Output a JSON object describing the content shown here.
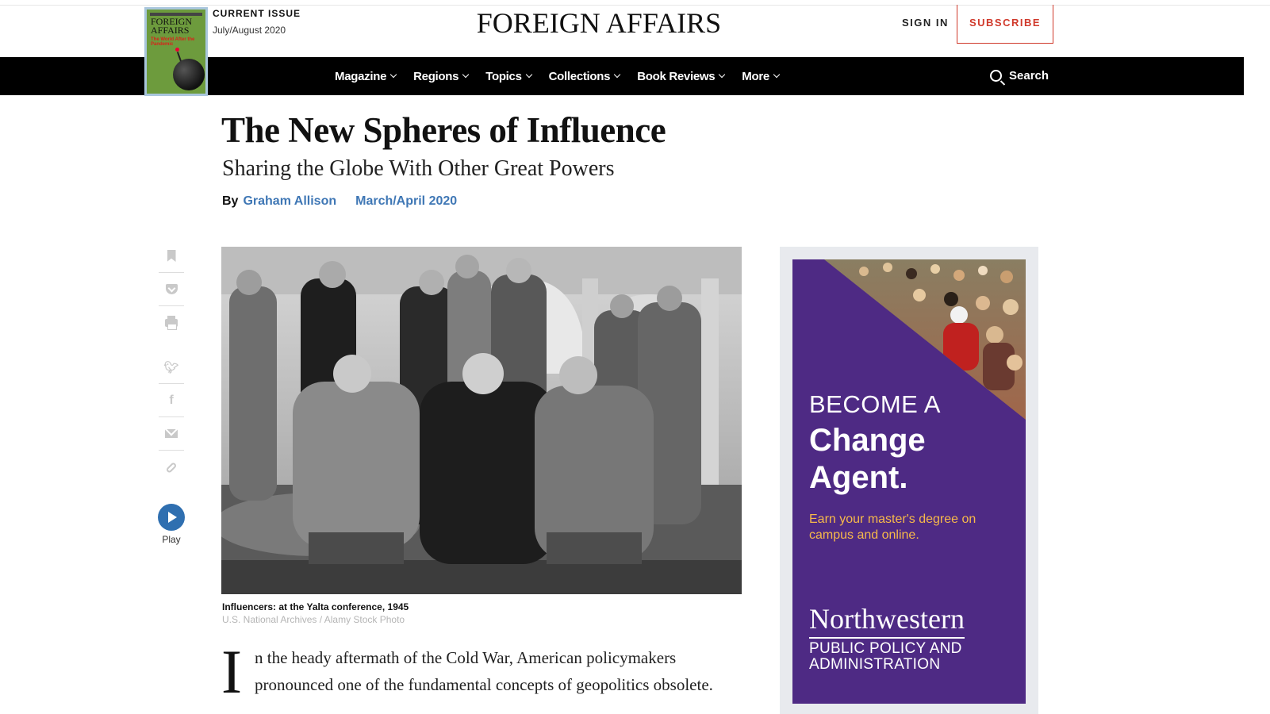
{
  "header": {
    "current_issue_label": "CURRENT ISSUE",
    "current_issue_date": "July/August 2020",
    "cover": {
      "logo": "FOREIGN AFFAIRS",
      "cover_line": "The World After the Pandemic"
    },
    "logo": "FOREIGN AFFAIRS",
    "sign_in": "SIGN IN",
    "subscribe": "SUBSCRIBE"
  },
  "nav": {
    "items": [
      {
        "label": "Magazine"
      },
      {
        "label": "Regions"
      },
      {
        "label": "Topics"
      },
      {
        "label": "Collections"
      },
      {
        "label": "Book Reviews"
      },
      {
        "label": "More"
      }
    ],
    "search_label": "Search"
  },
  "article": {
    "title": "The New Spheres of Influence",
    "subtitle": "Sharing the Globe With Other Great Powers",
    "by_label": "By",
    "author": "Graham Allison",
    "issue": "March/April 2020",
    "image_caption": "Influencers: at the Yalta conference, 1945",
    "image_credit": "U.S. National Archives / Alamy Stock Photo",
    "dropcap": "I",
    "first_paragraph": "n the heady aftermath of the Cold War, American policymakers pronounced one of the fundamental concepts of geopolitics obsolete."
  },
  "share_bar": {
    "icons": [
      "bookmark-icon",
      "pocket-icon",
      "print-icon",
      "twitter-icon",
      "facebook-icon",
      "email-icon",
      "link-icon"
    ],
    "play_label": "Play"
  },
  "ad": {
    "headline_line1": "BECOME A",
    "headline_line2": "Change",
    "headline_line3": "Agent.",
    "tagline": "Earn your master's degree on campus and online.",
    "brand": "Northwestern",
    "program": "PUBLIC POLICY AND ADMINISTRATION",
    "colors": {
      "background": "#4e2a84",
      "accent": "#f7b94a"
    }
  },
  "colors": {
    "link": "#3f77b5",
    "subscribe": "#d0392b",
    "nav_bg": "#000000"
  }
}
